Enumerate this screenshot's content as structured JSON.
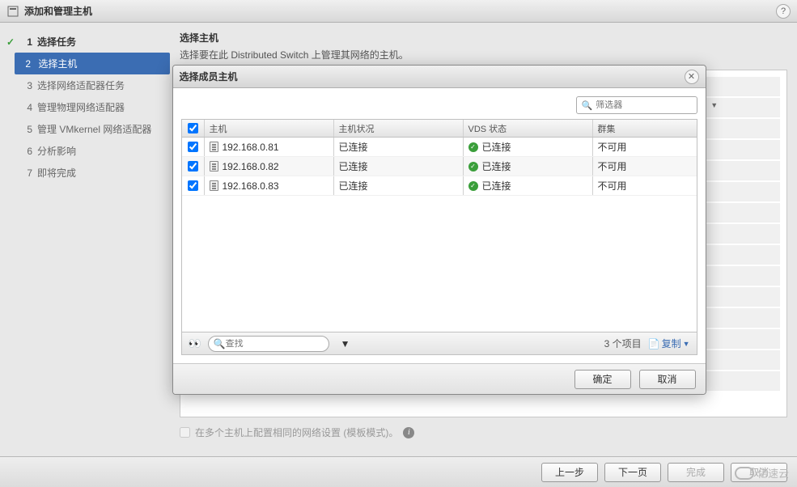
{
  "window": {
    "title": "添加和管理主机"
  },
  "steps": [
    {
      "num": "1",
      "label": "选择任务"
    },
    {
      "num": "2",
      "label": "选择主机"
    },
    {
      "num": "3",
      "label": "选择网络适配器任务"
    },
    {
      "num": "4",
      "label": "管理物理网络适配器"
    },
    {
      "num": "5",
      "label": "管理 VMkernel 网络适配器"
    },
    {
      "num": "6",
      "label": "分析影响"
    },
    {
      "num": "7",
      "label": "即将完成"
    }
  ],
  "content": {
    "title": "选择主机",
    "desc": "选择要在此 Distributed Switch 上管理其网络的主机。",
    "template_label": "在多个主机上配置相同的网络设置 (模板模式)。"
  },
  "modal": {
    "title": "选择成员主机",
    "filter_placeholder": "筛选器",
    "columns": {
      "host": "主机",
      "status": "主机状况",
      "vds": "VDS 状态",
      "cluster": "群集"
    },
    "rows": [
      {
        "host": "192.168.0.81",
        "status": "已连接",
        "vds": "已连接",
        "cluster": "不可用"
      },
      {
        "host": "192.168.0.82",
        "status": "已连接",
        "vds": "已连接",
        "cluster": "不可用"
      },
      {
        "host": "192.168.0.83",
        "status": "已连接",
        "vds": "已连接",
        "cluster": "不可用"
      }
    ],
    "find_placeholder": "查找",
    "item_count": "3 个项目",
    "copy_label": "复制",
    "ok_label": "确定",
    "cancel_label": "取消"
  },
  "footer": {
    "back": "上一步",
    "next": "下一页",
    "finish": "完成",
    "cancel": "取消"
  },
  "watermark": "亿速云"
}
